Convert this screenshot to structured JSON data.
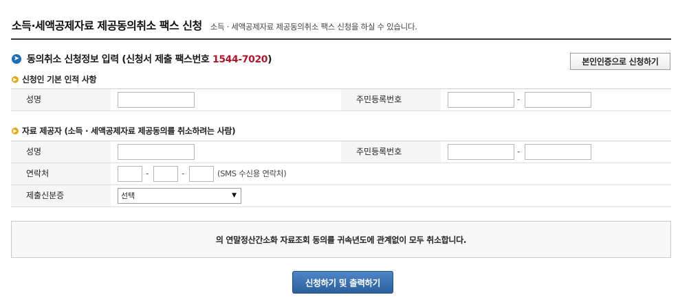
{
  "header": {
    "title": "소득·세액공제자료 제공동의취소 팩스 신청",
    "description": "소득 · 세액공제자료 제공동의취소 팩스 신청을 하실 수 있습니다."
  },
  "section": {
    "title_prefix": "동의취소 신청정보 입력 (신청서 제출 팩스번호",
    "fax_number": "1544-7020",
    "title_suffix": ")",
    "self_auth_button": "본인인증으로 신청하기"
  },
  "applicant": {
    "title": "신청인 기본 인적 사항",
    "name_label": "성명",
    "rrn_label": "주민등록번호",
    "name_value": "",
    "rrn_front": "",
    "rrn_back": "",
    "dash": "-"
  },
  "provider": {
    "title": "자료 제공자 (소득 · 세액공제자료 제공동의를 취소하려는 사람)",
    "name_label": "성명",
    "rrn_label": "주민등록번호",
    "contact_label": "연락처",
    "contact_note": "(SMS 수신용 연락처)",
    "id_label": "제출신분증",
    "id_select_value": "선택",
    "dash": "-"
  },
  "notice": {
    "text": "의 연말정산간소화 자료조회 동의를 귀속년도에 관계없이 모두 취소합니다."
  },
  "submit_button": "신청하기 및 출력하기",
  "colors": {
    "accent_blue": "#1f6fb8",
    "fax_red": "#b0172c",
    "bullet_yellow": "#e7a71a",
    "button_blue": "#2c5f9e"
  }
}
